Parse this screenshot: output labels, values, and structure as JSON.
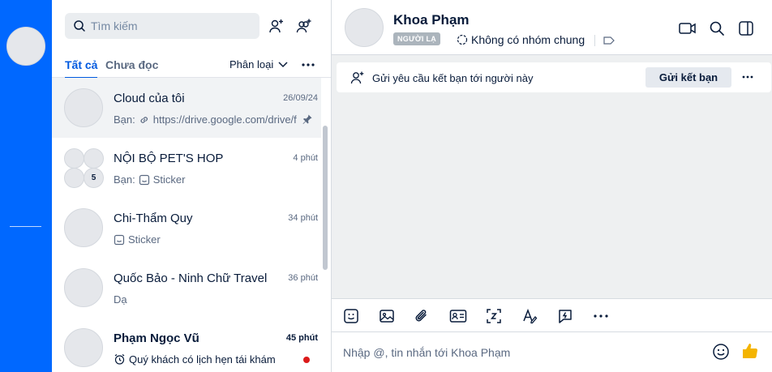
{
  "search": {
    "placeholder": "Tìm kiếm"
  },
  "list_header": {
    "tab_all": "Tất cả",
    "tab_unread": "Chưa đọc",
    "classify_label": "Phân loại"
  },
  "conversations": [
    {
      "name": "Cloud của tôi",
      "time": "26/09/24",
      "prefix": "Bạn:",
      "preview": "https://drive.google.com/drive/folders",
      "pinned": true
    },
    {
      "name": "NỘI BỘ PET'S HOP",
      "time": "4 phút",
      "prefix": "Bạn:",
      "preview": "Sticker",
      "member_count": "5"
    },
    {
      "name": "Chi-Thẩm Quy",
      "time": "34 phút",
      "preview": "Sticker"
    },
    {
      "name": "Quốc Bảo - Ninh Chữ Travel",
      "time": "36 phút",
      "preview": "Dạ"
    },
    {
      "name": "Phạm Ngọc Vũ",
      "time": "45 phút",
      "preview": "Quý khách có lịch hẹn tái khám",
      "unread": true
    }
  ],
  "chat": {
    "title": "Khoa Phạm",
    "stranger_badge": "NGƯỜI LẠ",
    "common_groups": "Không có nhóm chung",
    "friend_request_text": "Gửi yêu cầu kết bạn tới người này",
    "friend_button": "Gửi kết bạn",
    "input_placeholder": "Nhập @, tin nhắn tới Khoa Phạm"
  },
  "colors": {
    "accent": "#0068ff",
    "unread_dot": "#db1a1a"
  }
}
